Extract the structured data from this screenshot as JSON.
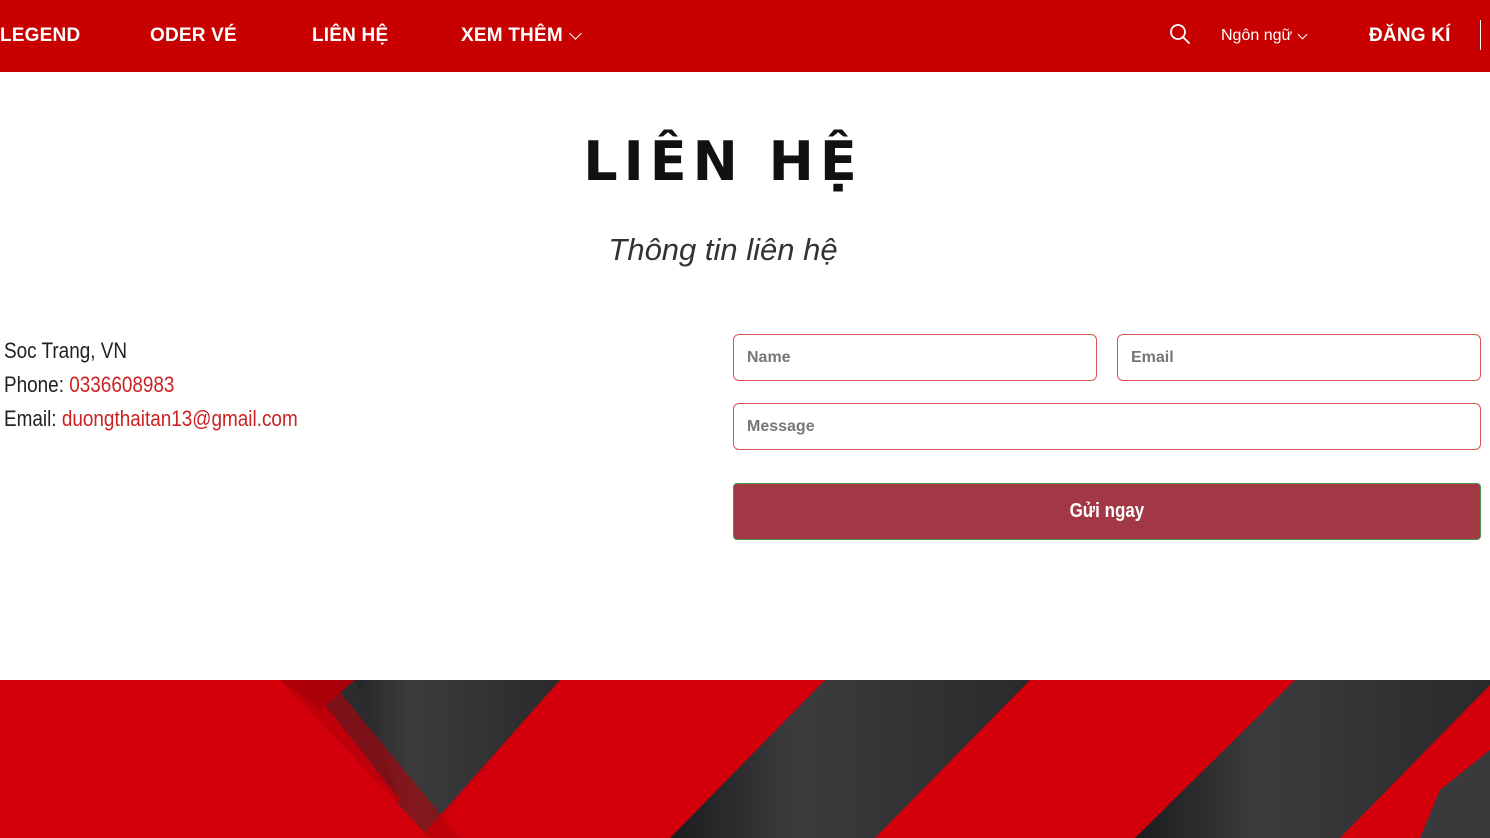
{
  "nav": {
    "items": [
      {
        "label": "LEGEND"
      },
      {
        "label": "ODER VÉ"
      },
      {
        "label": "LIÊN HỆ"
      },
      {
        "label": "XEM THÊM"
      }
    ],
    "language_label": "Ngôn ngữ",
    "register_label": "ĐĂNG KÍ",
    "search_icon": "search-icon"
  },
  "header": {
    "title": "LIÊN HỆ",
    "subtitle": "Thông tin liên hệ"
  },
  "contact": {
    "address": "Soc Trang, VN",
    "phone_label": "Phone: ",
    "phone": "0336608983",
    "email_label": "Email: ",
    "email": "duongthaitan13@gmail.com"
  },
  "form": {
    "name_placeholder": "Name",
    "email_placeholder": "Email",
    "message_placeholder": "Message",
    "submit_label": "Gửi ngay"
  },
  "colors": {
    "nav_bg": "#c80000",
    "accent": "#cc2222",
    "button_bg": "#a23745",
    "banner_red": "#d3000c",
    "banner_dark": "#3a3a3c"
  }
}
